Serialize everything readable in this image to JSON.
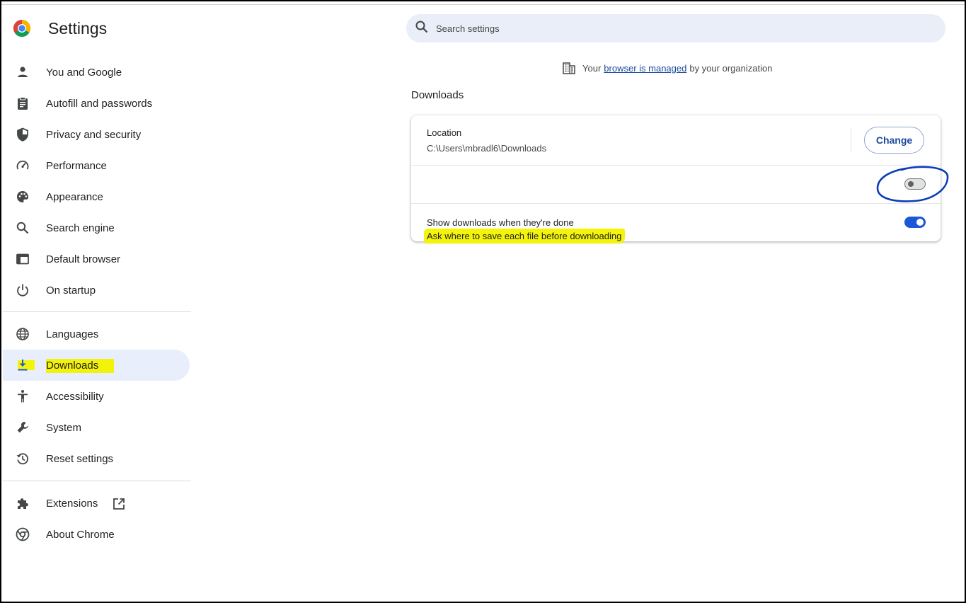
{
  "header": {
    "title": "Settings"
  },
  "search": {
    "placeholder": "Search settings"
  },
  "managed": {
    "prefix": "Your",
    "link": "browser is managed",
    "suffix": "by your organization"
  },
  "sidebar": {
    "items": [
      {
        "label": "You and Google",
        "icon": "person-icon"
      },
      {
        "label": "Autofill and passwords",
        "icon": "clipboard-icon"
      },
      {
        "label": "Privacy and security",
        "icon": "shield-icon"
      },
      {
        "label": "Performance",
        "icon": "speedometer-icon"
      },
      {
        "label": "Appearance",
        "icon": "palette-icon"
      },
      {
        "label": "Search engine",
        "icon": "search-icon"
      },
      {
        "label": "Default browser",
        "icon": "browser-window-icon"
      },
      {
        "label": "On startup",
        "icon": "power-icon"
      },
      {
        "label": "Languages",
        "icon": "globe-icon"
      },
      {
        "label": "Downloads",
        "icon": "download-icon",
        "selected": true
      },
      {
        "label": "Accessibility",
        "icon": "accessibility-icon"
      },
      {
        "label": "System",
        "icon": "wrench-icon"
      },
      {
        "label": "Reset settings",
        "icon": "history-icon"
      },
      {
        "label": "Extensions",
        "icon": "puzzle-icon"
      },
      {
        "label": "About Chrome",
        "icon": "chrome-icon"
      }
    ]
  },
  "downloads": {
    "section_title": "Downloads",
    "location_label": "Location",
    "location_path": "C:\\Users\\mbradl6\\Downloads",
    "change_button": "Change",
    "ask_label": "Ask where to save each file before downloading",
    "ask_enabled": false,
    "show_label": "Show downloads when they're done",
    "show_enabled": true
  },
  "colors": {
    "accent": "#1b57d6",
    "highlight": "#f4f40b",
    "selected_bg": "#e8eefc",
    "annotation": "#0b3db8"
  }
}
